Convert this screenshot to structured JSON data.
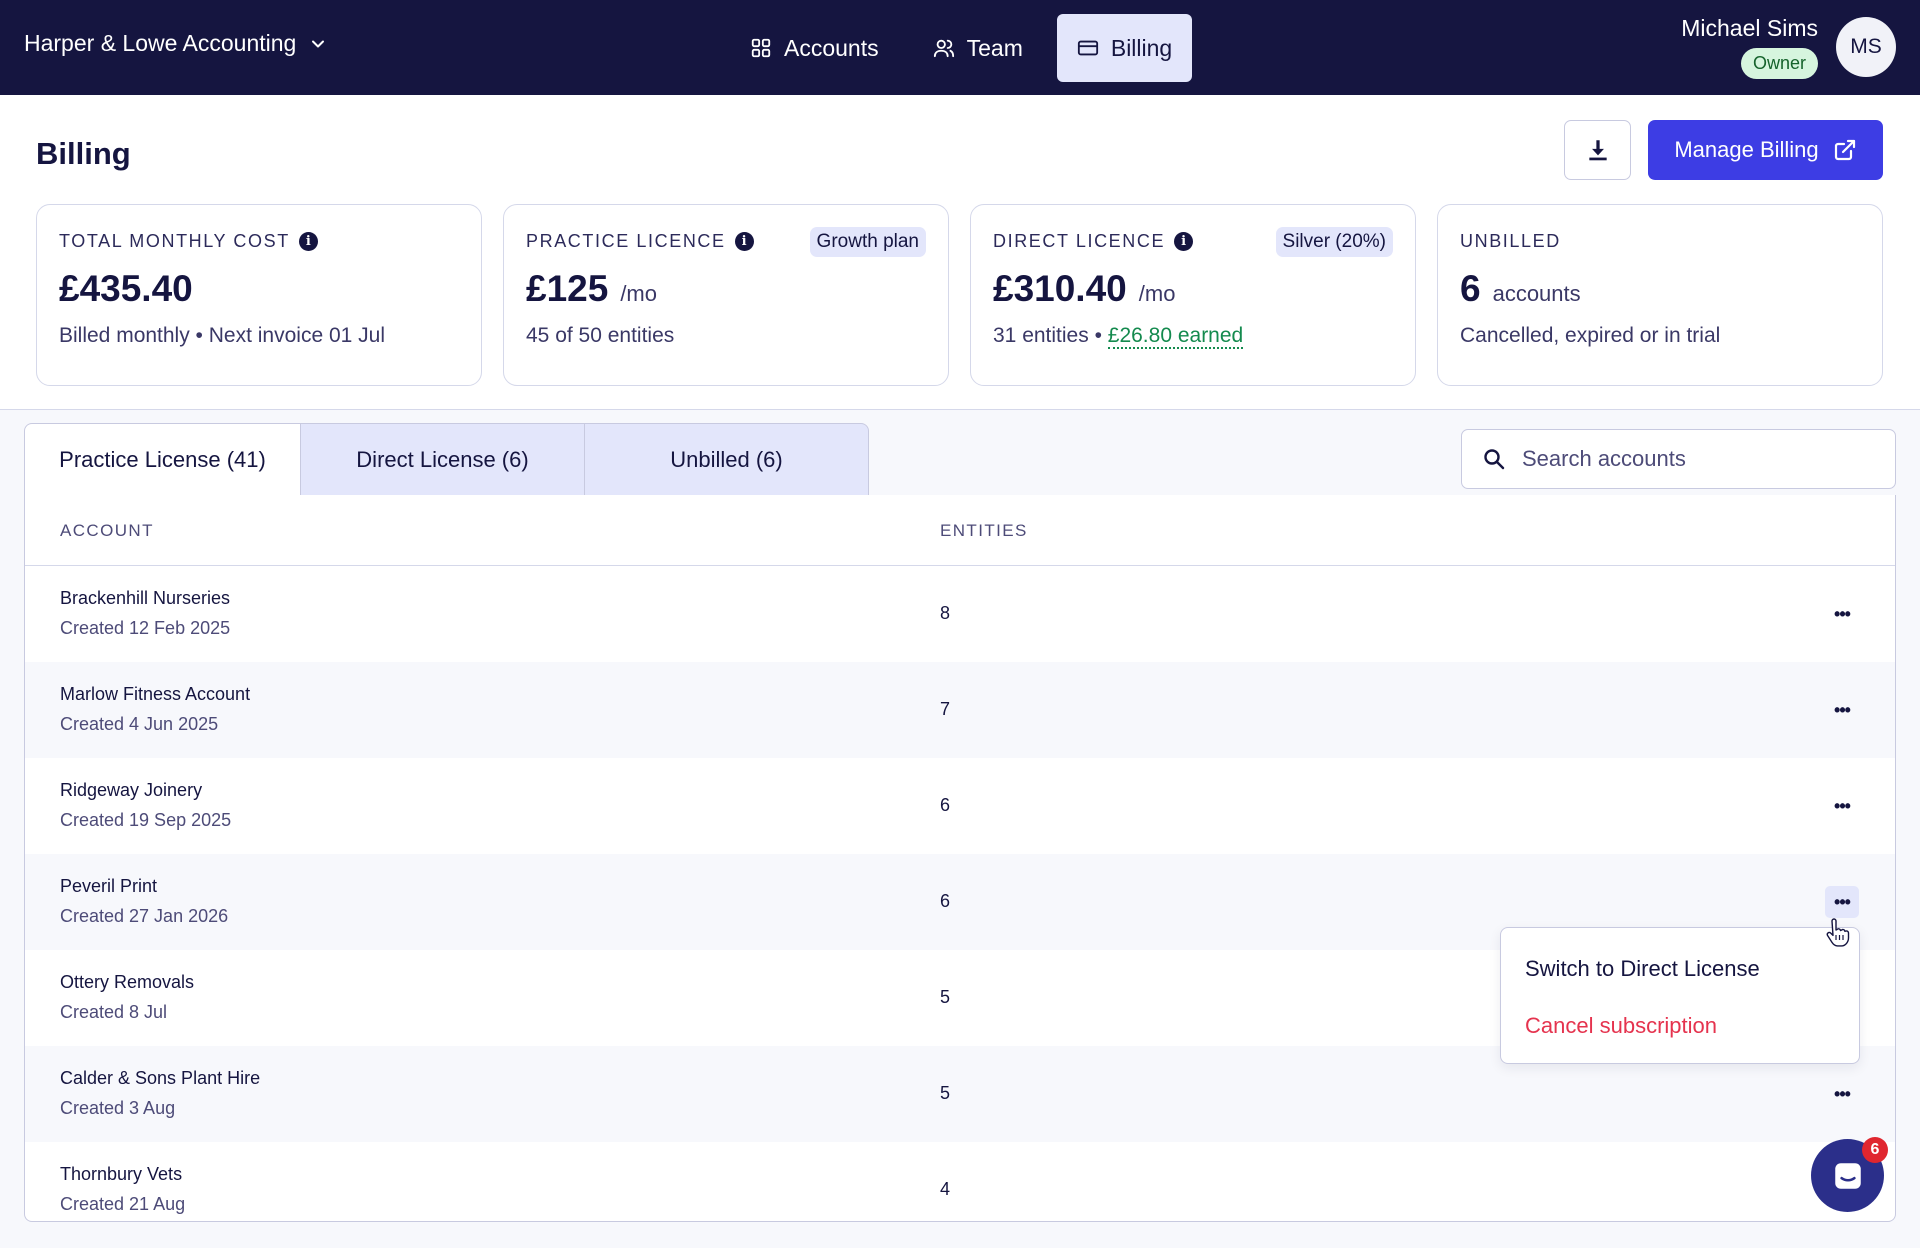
{
  "topbar": {
    "org_name": "Harper & Lowe Accounting",
    "nav": [
      {
        "label": "Accounts",
        "icon": "grid-icon"
      },
      {
        "label": "Team",
        "icon": "users-icon"
      },
      {
        "label": "Billing",
        "icon": "credit-card-icon",
        "active": true
      }
    ],
    "user": {
      "name": "Michael Sims",
      "role": "Owner",
      "initials": "MS"
    }
  },
  "page": {
    "title": "Billing",
    "manage_billing_label": "Manage Billing"
  },
  "cards": [
    {
      "label": "TOTAL MONTHLY COST",
      "value": "£435.40",
      "unit": "",
      "sub": "Billed monthly • Next invoice 01 Jul",
      "badge": ""
    },
    {
      "label": "PRACTICE LICENCE",
      "value": "£125",
      "unit": "/mo",
      "sub": "45 of 50 entities",
      "badge": "Growth plan"
    },
    {
      "label": "DIRECT LICENCE",
      "value": "£310.40",
      "unit": "/mo",
      "sub": "31 entities",
      "sub_sep": " • ",
      "sub_earned": "£26.80 earned",
      "badge": "Silver (20%)"
    },
    {
      "label": "UNBILLED",
      "value": "6",
      "unit": "accounts",
      "sub": "Cancelled, expired or in trial",
      "badge": ""
    }
  ],
  "tabs": [
    {
      "label": "Practice License (41)",
      "active": true
    },
    {
      "label": "Direct License (6)",
      "active": false
    },
    {
      "label": "Unbilled (6)",
      "active": false
    }
  ],
  "search": {
    "placeholder": "Search accounts"
  },
  "table": {
    "headers": {
      "account": "ACCOUNT",
      "entities": "ENTITIES"
    },
    "rows": [
      {
        "name": "Brackenhill Nurseries",
        "created": "Created 12 Feb 2025",
        "entities": "8"
      },
      {
        "name": "Marlow Fitness Account",
        "created": "Created 4 Jun 2025",
        "entities": "7"
      },
      {
        "name": "Ridgeway Joinery",
        "created": "Created 19 Sep 2025",
        "entities": "6"
      },
      {
        "name": "Peveril Print",
        "created": "Created 27 Jan 2026",
        "entities": "6"
      },
      {
        "name": "Ottery Removals",
        "created": "Created 8 Jul",
        "entities": "5"
      },
      {
        "name": "Calder & Sons Plant Hire",
        "created": "Created 3 Aug",
        "entities": "5"
      },
      {
        "name": "Thornbury Vets",
        "created": "Created 21 Aug",
        "entities": "4"
      }
    ],
    "more_label": "•••"
  },
  "row_menu": {
    "switch_label": "Switch to Direct License",
    "cancel_label": "Cancel subscription"
  },
  "chat": {
    "badge_count": "6"
  },
  "colors": {
    "topbar": "#151540",
    "primary": "#3d3de4",
    "active_tab": "#e3e6fb",
    "success": "#148a4e",
    "danger": "#e5334e",
    "owner_badge": "#d6f5de"
  }
}
